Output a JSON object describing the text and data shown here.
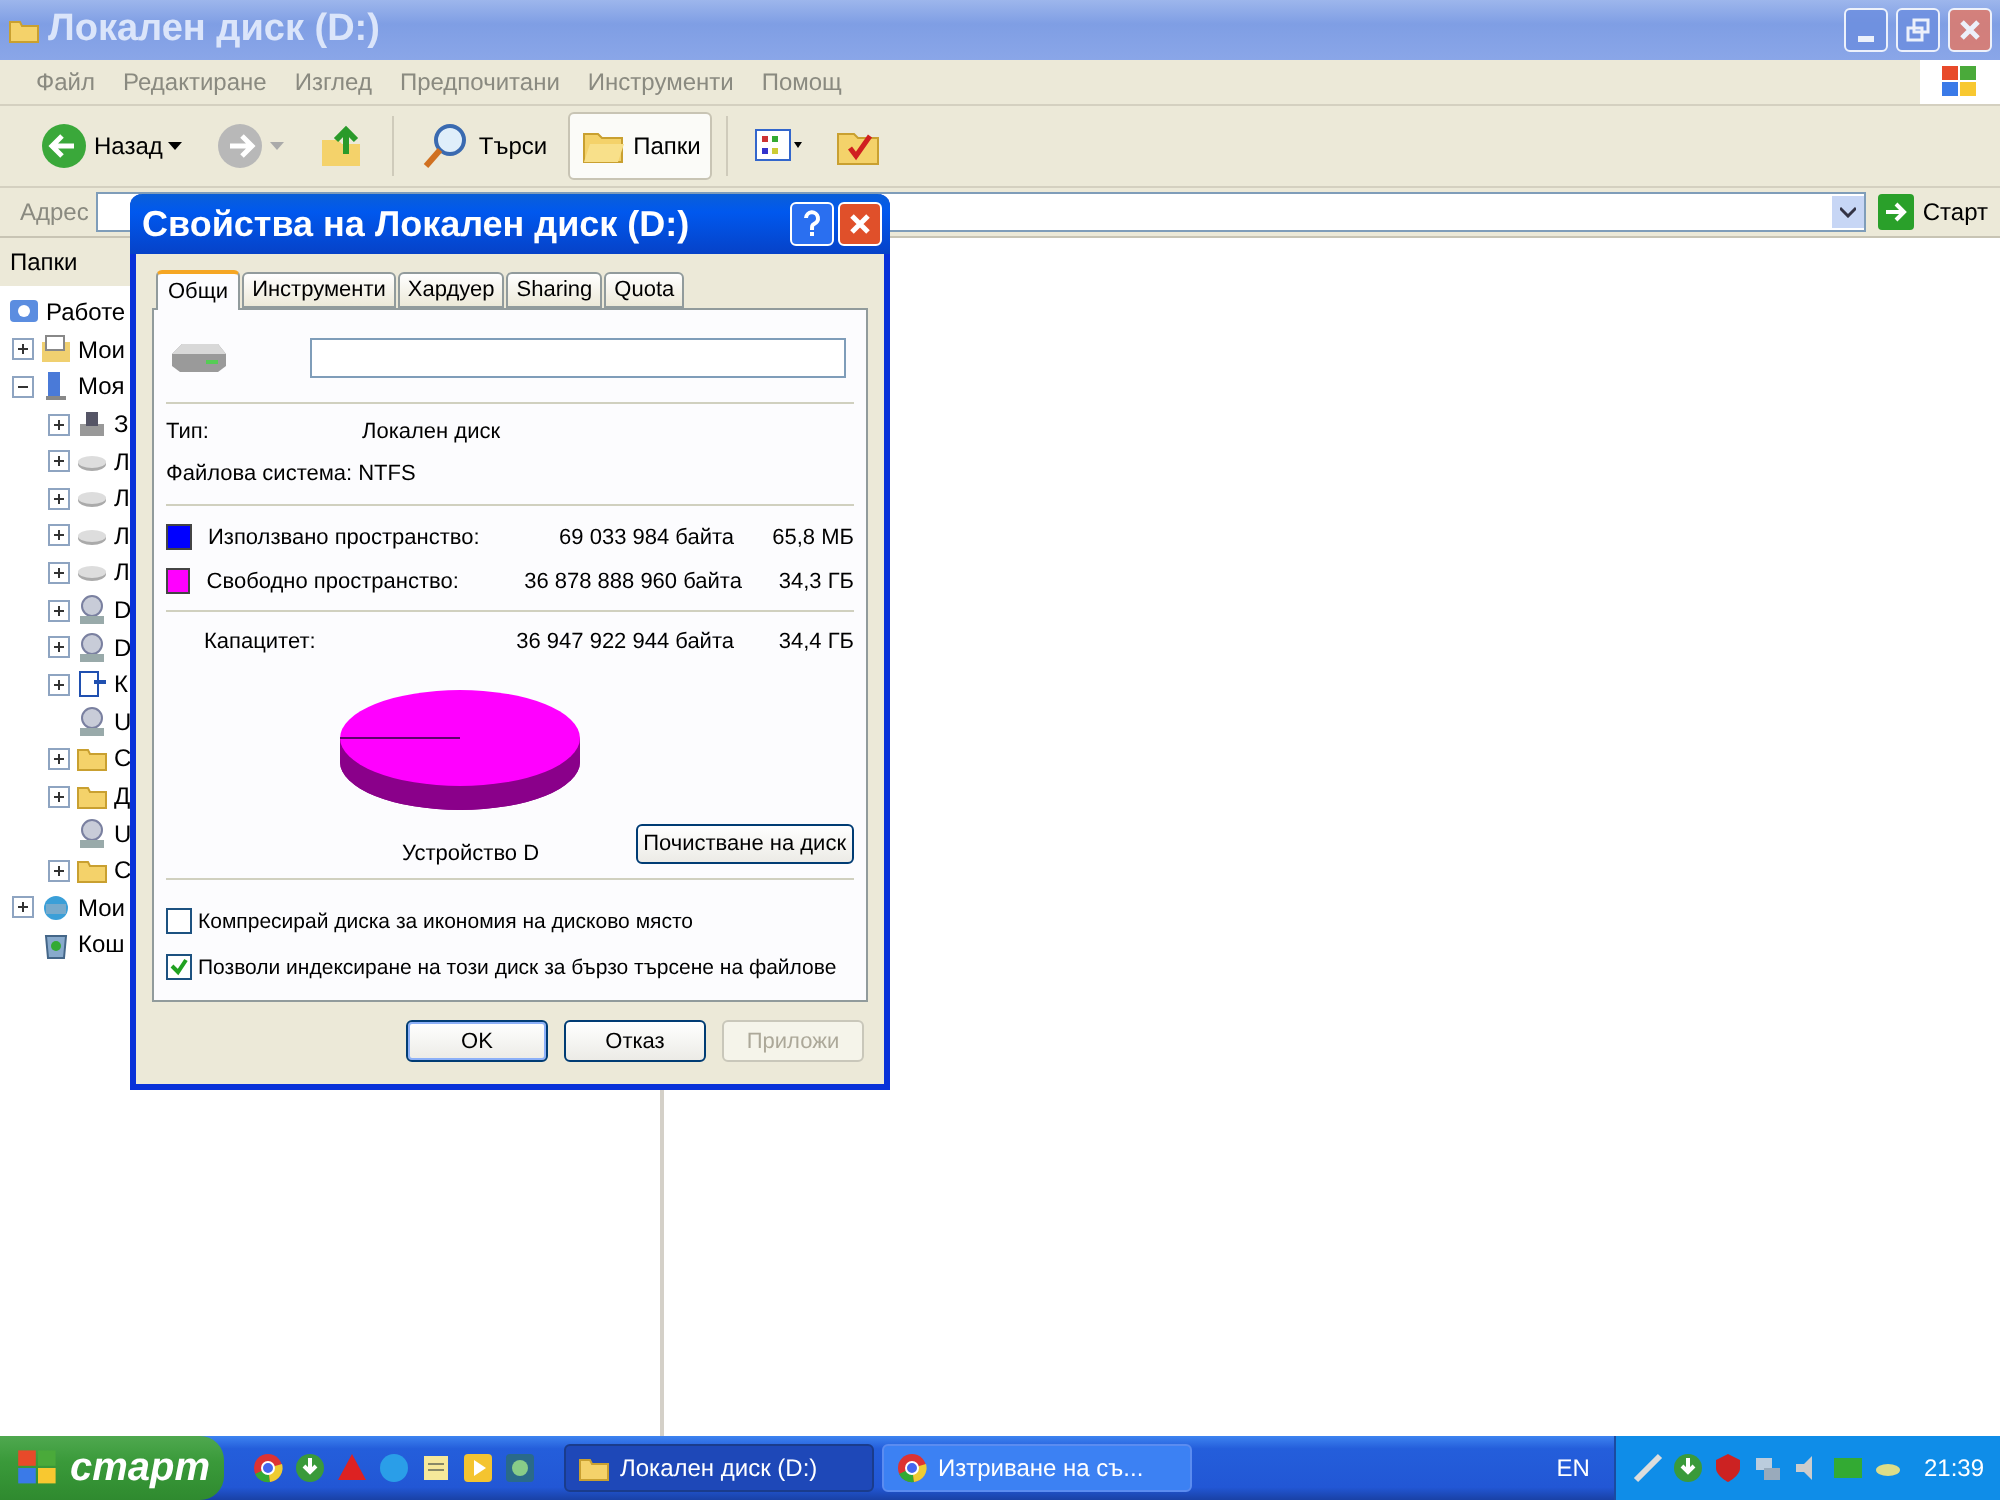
{
  "window": {
    "title": "Локален диск (D:)",
    "active": false
  },
  "menu": [
    "Файл",
    "Редактиране",
    "Изглед",
    "Предпочитани",
    "Инструменти",
    "Помощ"
  ],
  "toolbar": [
    {
      "kind": "back",
      "label": "Назад",
      "pressed": false
    },
    {
      "kind": "forward",
      "pressed": false
    },
    {
      "kind": "up",
      "pressed": false
    },
    {
      "kind": "search",
      "label": "Търси",
      "pressed": false
    },
    {
      "kind": "folders",
      "label": "Папки",
      "pressed": true
    },
    {
      "kind": "views",
      "pressed": false
    },
    {
      "kind": "sync",
      "pressed": false
    }
  ],
  "address": {
    "label": "Адрес",
    "go": "Старт"
  },
  "folders_pane": {
    "title": "Папки",
    "tree": [
      {
        "label": "Работе",
        "kind": "desktop",
        "children": [
          {
            "label": "Мои",
            "kind": "docs",
            "expanded": false
          },
          {
            "label": "Моя",
            "kind": "computer",
            "expanded": true,
            "children": [
              {
                "label": "З",
                "kind": "floppy",
                "expanded": false
              },
              {
                "label": "Л",
                "kind": "drive",
                "expanded": false
              },
              {
                "label": "Л",
                "kind": "drive",
                "expanded": false
              },
              {
                "label": "Л",
                "kind": "drive",
                "expanded": false
              },
              {
                "label": "Л",
                "kind": "drive",
                "expanded": false
              },
              {
                "label": "D",
                "kind": "cd",
                "expanded": false
              },
              {
                "label": "D",
                "kind": "cd",
                "expanded": false
              },
              {
                "label": "К",
                "kind": "control",
                "expanded": false
              },
              {
                "label": "U",
                "kind": "cd"
              },
              {
                "label": "С",
                "kind": "folder",
                "expanded": false
              },
              {
                "label": "Д",
                "kind": "folder",
                "expanded": false
              },
              {
                "label": "U",
                "kind": "cd"
              },
              {
                "label": "С",
                "kind": "folder",
                "expanded": false
              }
            ]
          },
          {
            "label": "Мои",
            "kind": "network",
            "expanded": false
          },
          {
            "label": "Кош",
            "kind": "recycle"
          }
        ]
      }
    ]
  },
  "dialog": {
    "title": "Свойства на Локален диск (D:)",
    "tabs": [
      {
        "label": "Общи",
        "selected": true
      },
      {
        "label": "Инструменти",
        "selected": false
      },
      {
        "label": "Хардуер",
        "selected": false
      },
      {
        "label": "Sharing",
        "selected": false
      },
      {
        "label": "Quota",
        "selected": false
      }
    ],
    "type": {
      "label": "Тип:",
      "value": "Локален диск"
    },
    "file_system": {
      "label": "Файлова система:",
      "value": "NTFS"
    },
    "space": [
      {
        "label": "Използвано пространство:",
        "bytes": "69 033 984 байта",
        "size": "65,8 МБ",
        "color": "#0000ff"
      },
      {
        "label": "Свободно пространство:",
        "bytes": "36 878 888 960 байта",
        "size": "34,3 ГБ",
        "color": "#ff00ff"
      }
    ],
    "capacity": {
      "label": "Капацитет:",
      "bytes": "36 947 922 944 байта",
      "size": "34,4 ГБ"
    },
    "drive_label": "Устройство D",
    "cleanup_button": "Почистване на диск",
    "checkboxes": [
      {
        "label": "Компресирай диска за икономия на дисково място",
        "checked": false
      },
      {
        "label": "Позволи индексиране на този диск за бързо търсене на файлове",
        "checked": true
      }
    ],
    "buttons": [
      {
        "label": "OK",
        "disabled": false,
        "default": true
      },
      {
        "label": "Отказ",
        "disabled": false,
        "default": false
      },
      {
        "label": "Приложи",
        "disabled": true,
        "default": false
      }
    ]
  },
  "taskbar": {
    "start": "старт",
    "quick_launch": [
      {
        "kind": "chrome"
      },
      {
        "kind": "torrent"
      },
      {
        "kind": "acrobat"
      },
      {
        "kind": "globe"
      },
      {
        "kind": "notes"
      },
      {
        "kind": "media"
      },
      {
        "kind": "r"
      }
    ],
    "tasks": [
      {
        "label": "Локален диск (D:)",
        "kind": "folder",
        "selected": true
      },
      {
        "label": "Изтриване на съ...",
        "kind": "chrome",
        "selected": false
      }
    ],
    "language": "EN",
    "clock": "21:39"
  }
}
